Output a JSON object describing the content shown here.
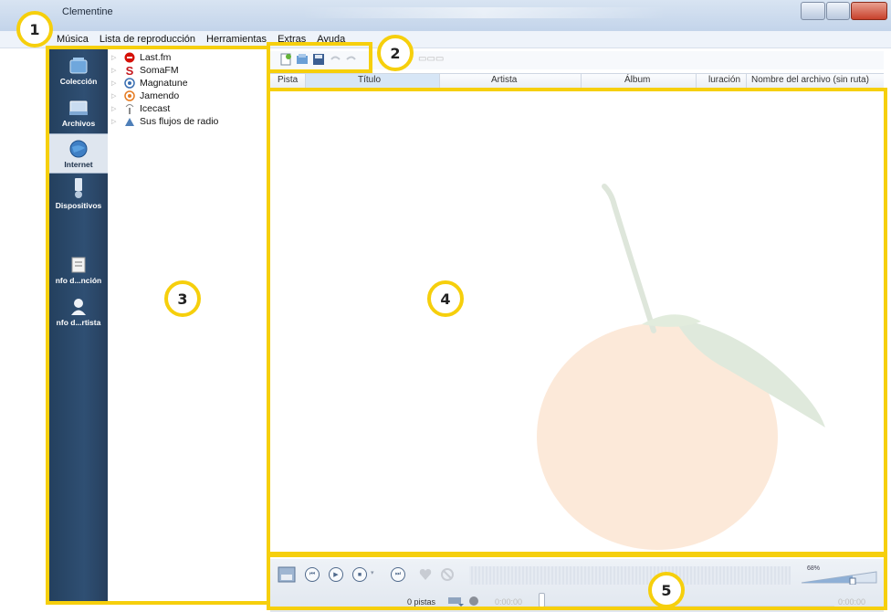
{
  "window": {
    "title": "Clementine"
  },
  "menu": [
    "Música",
    "Lista de reproducción",
    "Herramientas",
    "Extras",
    "Ayuda"
  ],
  "sidebar_tabs": [
    {
      "label": "Colección",
      "icon": "library-icon"
    },
    {
      "label": "Archivos",
      "icon": "files-icon"
    },
    {
      "label": "Internet",
      "icon": "internet-globe-icon",
      "active": true
    },
    {
      "label": "Dispositivos",
      "icon": "devices-icon"
    },
    {
      "label": "nfo d...nción",
      "icon": "song-info-icon"
    },
    {
      "label": "nfo d...rtista",
      "icon": "artist-info-icon"
    }
  ],
  "tree_items": [
    {
      "label": "Last.fm",
      "icon": "lastfm-icon"
    },
    {
      "label": "SomaFM",
      "icon": "somafm-icon"
    },
    {
      "label": "Magnatune",
      "icon": "magnatune-icon"
    },
    {
      "label": "Jamendo",
      "icon": "jamendo-icon"
    },
    {
      "label": "Icecast",
      "icon": "icecast-icon"
    },
    {
      "label": "Sus flujos de radio",
      "icon": "radio-streams-icon"
    }
  ],
  "playlist": {
    "columns": [
      "Pista",
      "Título",
      "Artista",
      "Álbum",
      "luración",
      "Nombre del archivo (sin ruta)"
    ]
  },
  "player": {
    "track_count": "0 pistas",
    "time_elapsed": "0:00:00",
    "time_total": "0:00:00",
    "volume_label": "68%"
  },
  "annotations": [
    "1",
    "2",
    "3",
    "4",
    "5"
  ],
  "colors": {
    "annotation": "#f6cf0c",
    "sidebar": "#2f4f73",
    "titlebar": "#c3d4ea"
  }
}
